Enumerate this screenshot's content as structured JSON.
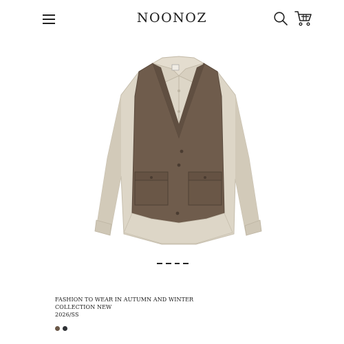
{
  "header": {
    "brand": "NOONOZ",
    "menu_icon": "hamburger-menu-icon",
    "search_icon": "search-icon",
    "cart_icon": "shopping-cart-icon"
  },
  "product": {
    "image_icon": "product-photo-layered-vest-over-shirt",
    "title_line1": "FASHION TO WEAR IN AUTUMN AND WINTER",
    "title_line2": "COLLECTION NEW",
    "season": "2026/SS",
    "colors": [
      "#6b5848",
      "#2f3235"
    ]
  },
  "carousel": {
    "slide_count": 4
  }
}
